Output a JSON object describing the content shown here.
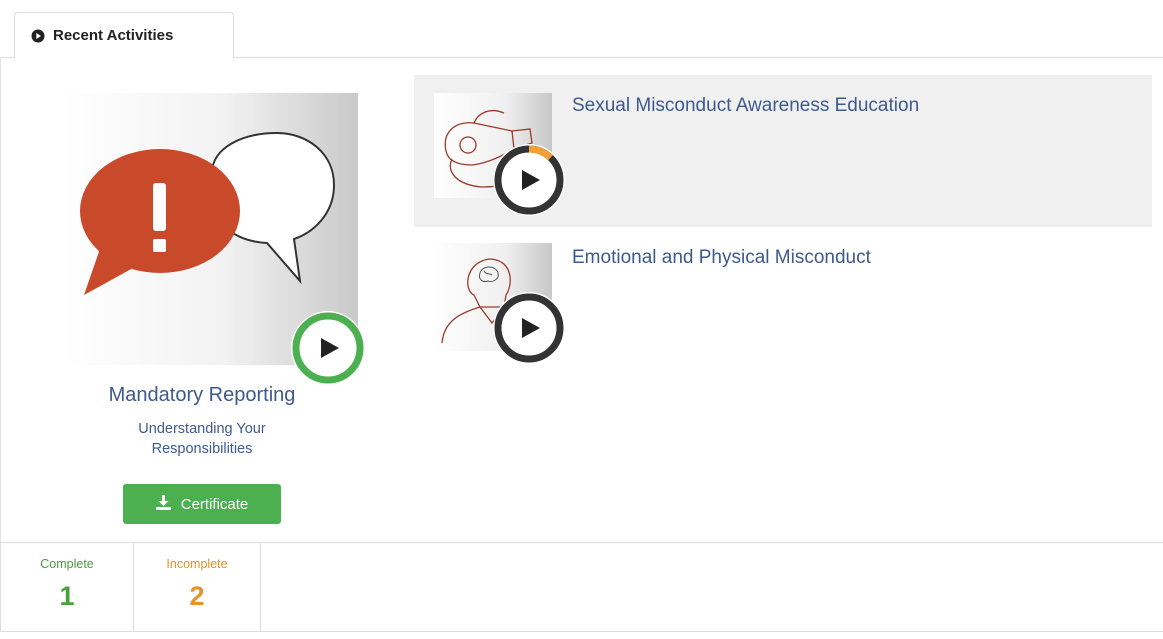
{
  "tab": {
    "label": "Recent Activities",
    "icon": "circle-play-icon"
  },
  "featured": {
    "title": "Mandatory Reporting",
    "subtitle": "Understanding Your Responsibilities",
    "certificate_label": "Certificate",
    "thumbnail_icon": "speech-bubbles-alert-icon",
    "progress": 1.0,
    "progress_color": "#4caf50"
  },
  "activities": [
    {
      "title": "Sexual Misconduct Awareness Education",
      "thumbnail_icon": "whistle-icon",
      "progress": 0.12,
      "progress_color": "#f0a035",
      "highlighted": true
    },
    {
      "title": "Emotional and Physical Misconduct",
      "thumbnail_icon": "head-brain-icon",
      "progress": 0.0,
      "progress_color": "#f0a035",
      "highlighted": false
    }
  ],
  "stats": {
    "complete": {
      "label": "Complete",
      "value": "1",
      "color": "#4a9e3d"
    },
    "incomplete": {
      "label": "Incomplete",
      "value": "2",
      "color": "#e6912c"
    }
  },
  "colors": {
    "link": "#3d5a8f",
    "button": "#4caf50",
    "highlight": "#f0f0f0"
  }
}
